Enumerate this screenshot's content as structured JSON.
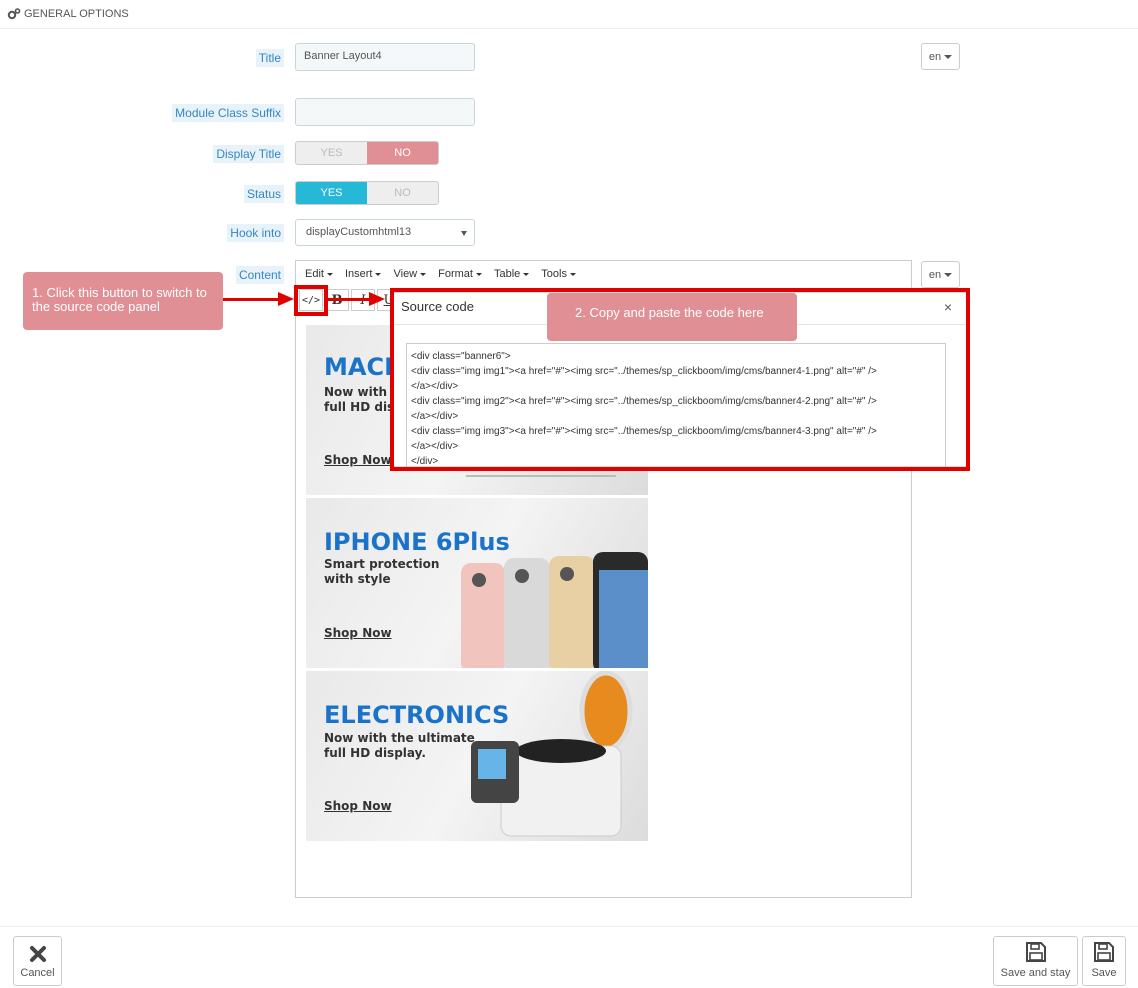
{
  "panel": {
    "heading": "GENERAL OPTIONS"
  },
  "form": {
    "title_label": "Title",
    "title_value": "Banner Layout4",
    "lang": "en",
    "suffix_label": "Module Class Suffix",
    "suffix_value": "",
    "display_title_label": "Display Title",
    "display_title_yes": "YES",
    "display_title_no": "NO",
    "status_label": "Status",
    "status_yes": "YES",
    "status_no": "NO",
    "hook_label": "Hook into",
    "hook_value": "displayCustomhtml13",
    "content_label": "Content",
    "content_lang": "en"
  },
  "editor": {
    "menus": [
      "Edit",
      "Insert",
      "View",
      "Format",
      "Table",
      "Tools"
    ],
    "toolbar": {
      "source": "</>",
      "bold": "B",
      "italic": "I",
      "underline": "U"
    }
  },
  "banners": [
    {
      "title": "MACE",
      "subtitle_line1": "Now with t",
      "subtitle_line2": "full HD disp",
      "cta": "Shop Now"
    },
    {
      "title": "IPHONE 6Plus",
      "subtitle_line1": "Smart protection",
      "subtitle_line2": "with style",
      "cta": "Shop Now"
    },
    {
      "title": "ELECTRONICS",
      "subtitle_line1": "Now with the ultimate",
      "subtitle_line2": "full HD display.",
      "cta": "Shop Now"
    }
  ],
  "modal": {
    "title": "Source code",
    "close": "×",
    "code": "<div class=\"banner6\">\n<div class=\"img img1\"><a href=\"#\"><img src=\"../themes/sp_clickboom/img/cms/banner4-1.png\" alt=\"#\" />\n</a></div>\n<div class=\"img img2\"><a href=\"#\"><img src=\"../themes/sp_clickboom/img/cms/banner4-2.png\" alt=\"#\" />\n</a></div>\n<div class=\"img img3\"><a href=\"#\"><img src=\"../themes/sp_clickboom/img/cms/banner4-3.png\" alt=\"#\" />\n</a></div>\n</div>"
  },
  "annotations": {
    "step1": "1. Click this button to switch to the source code panel",
    "step2": "2. Copy and paste the code here"
  },
  "footer": {
    "cancel": "Cancel",
    "save_stay": "Save and stay",
    "save": "Save"
  },
  "colors": {
    "accent": "#25b9d7",
    "no_on": "#e08f95",
    "annotation_red": "#e10000",
    "callout": "#e08f95"
  },
  "icons": {
    "heading": "gears-icon",
    "cancel": "close-icon",
    "save": "floppy-disk-icon"
  }
}
